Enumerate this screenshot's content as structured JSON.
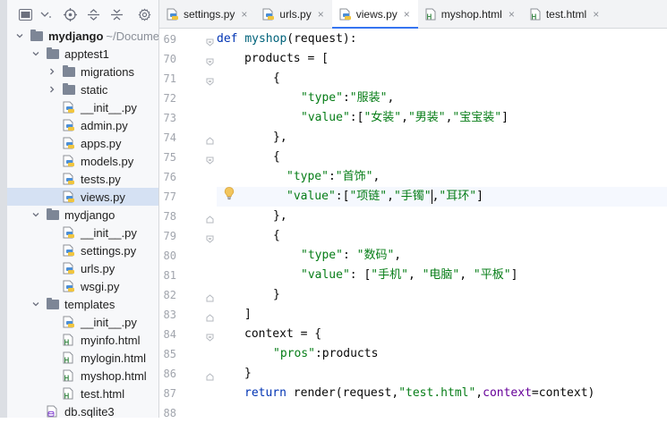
{
  "toolbar": {
    "icons": [
      "project-view-icon",
      "dropdown-icon",
      "locate-icon",
      "expand-all-icon",
      "collapse-all-icon",
      "settings-icon"
    ]
  },
  "tree": [
    {
      "label": "mydjango",
      "sub": "~/Documen",
      "kind": "folder",
      "depth": 0,
      "expanded": true,
      "bold": true
    },
    {
      "label": "apptest1",
      "kind": "folder",
      "depth": 1,
      "expanded": true
    },
    {
      "label": "migrations",
      "kind": "folder",
      "depth": 2,
      "expanded": false
    },
    {
      "label": "static",
      "kind": "folder",
      "depth": 2,
      "expanded": false
    },
    {
      "label": "__init__.py",
      "kind": "py",
      "depth": 2
    },
    {
      "label": "admin.py",
      "kind": "py",
      "depth": 2
    },
    {
      "label": "apps.py",
      "kind": "py",
      "depth": 2
    },
    {
      "label": "models.py",
      "kind": "py",
      "depth": 2
    },
    {
      "label": "tests.py",
      "kind": "py",
      "depth": 2
    },
    {
      "label": "views.py",
      "kind": "py",
      "depth": 2,
      "selected": true
    },
    {
      "label": "mydjango",
      "kind": "folder",
      "depth": 1,
      "expanded": true
    },
    {
      "label": "__init__.py",
      "kind": "py",
      "depth": 2
    },
    {
      "label": "settings.py",
      "kind": "py",
      "depth": 2
    },
    {
      "label": "urls.py",
      "kind": "py",
      "depth": 2
    },
    {
      "label": "wsgi.py",
      "kind": "py",
      "depth": 2
    },
    {
      "label": "templates",
      "kind": "folder",
      "depth": 1,
      "expanded": true
    },
    {
      "label": "__init__.py",
      "kind": "py",
      "depth": 2
    },
    {
      "label": "myinfo.html",
      "kind": "html",
      "depth": 2
    },
    {
      "label": "mylogin.html",
      "kind": "html",
      "depth": 2
    },
    {
      "label": "myshop.html",
      "kind": "html",
      "depth": 2
    },
    {
      "label": "test.html",
      "kind": "html",
      "depth": 2
    },
    {
      "label": "db.sqlite3",
      "kind": "db",
      "depth": 1
    }
  ],
  "tabs": [
    {
      "label": "settings.py",
      "kind": "py",
      "active": false
    },
    {
      "label": "urls.py",
      "kind": "py",
      "active": false
    },
    {
      "label": "views.py",
      "kind": "py",
      "active": true
    },
    {
      "label": "myshop.html",
      "kind": "html",
      "active": false
    },
    {
      "label": "test.html",
      "kind": "html",
      "active": false
    }
  ],
  "tab_close_glyph": "×",
  "editor": {
    "current_line": 77,
    "lines": [
      {
        "n": 69,
        "indent": 0,
        "tokens": [
          [
            "kw",
            "def "
          ],
          [
            "fn",
            "myshop"
          ],
          [
            "",
            "(request):"
          ]
        ],
        "fold": "open"
      },
      {
        "n": 70,
        "indent": 1,
        "tokens": [
          [
            "",
            "products = ["
          ]
        ],
        "fold": "open"
      },
      {
        "n": 71,
        "indent": 2,
        "tokens": [
          [
            "",
            "{"
          ]
        ],
        "fold": "open"
      },
      {
        "n": 72,
        "indent": 3,
        "tokens": [
          [
            "str",
            "\"type\""
          ],
          [
            "",
            ":"
          ],
          [
            "str",
            "\"服装\""
          ],
          [
            "",
            ","
          ]
        ]
      },
      {
        "n": 73,
        "indent": 3,
        "tokens": [
          [
            "str",
            "\"value\""
          ],
          [
            "",
            ":["
          ],
          [
            "str",
            "\"女装\""
          ],
          [
            "",
            ","
          ],
          [
            "str",
            "\"男装\""
          ],
          [
            "",
            ","
          ],
          [
            "str",
            "\"宝宝装\""
          ],
          [
            "",
            "]"
          ]
        ]
      },
      {
        "n": 74,
        "indent": 2,
        "tokens": [
          [
            "",
            "},"
          ]
        ],
        "fold": "close"
      },
      {
        "n": 75,
        "indent": 2,
        "tokens": [
          [
            "",
            "{"
          ]
        ],
        "fold": "open"
      },
      {
        "n": 76,
        "indent": 2.5,
        "tokens": [
          [
            "str",
            "\"type\""
          ],
          [
            "",
            ":"
          ],
          [
            "str",
            "\"首饰\""
          ],
          [
            "",
            ","
          ]
        ]
      },
      {
        "n": 77,
        "indent": 2.5,
        "tokens": [
          [
            "str",
            "\"value\""
          ],
          [
            "",
            ":["
          ],
          [
            "str",
            "\"项链\""
          ],
          [
            "",
            ","
          ],
          [
            "str",
            "\"手镯\""
          ],
          [
            "caret",
            ""
          ],
          [
            "",
            ","
          ],
          [
            "str",
            "\"耳环\""
          ],
          [
            "",
            "]"
          ]
        ]
      },
      {
        "n": 78,
        "indent": 2,
        "tokens": [
          [
            "",
            "},"
          ]
        ],
        "fold": "close"
      },
      {
        "n": 79,
        "indent": 2,
        "tokens": [
          [
            "",
            "{"
          ]
        ],
        "fold": "open"
      },
      {
        "n": 80,
        "indent": 3,
        "tokens": [
          [
            "str",
            "\"type\""
          ],
          [
            "",
            ": "
          ],
          [
            "str",
            "\"数码\""
          ],
          [
            "",
            ","
          ]
        ]
      },
      {
        "n": 81,
        "indent": 3,
        "tokens": [
          [
            "str",
            "\"value\""
          ],
          [
            "",
            ": ["
          ],
          [
            "str",
            "\"手机\""
          ],
          [
            "",
            ", "
          ],
          [
            "str",
            "\"电脑\""
          ],
          [
            "",
            ", "
          ],
          [
            "str",
            "\"平板\""
          ],
          [
            "",
            "]"
          ]
        ]
      },
      {
        "n": 82,
        "indent": 2,
        "tokens": [
          [
            "",
            "}"
          ]
        ],
        "fold": "close"
      },
      {
        "n": 83,
        "indent": 1,
        "tokens": [
          [
            "",
            "]"
          ]
        ],
        "fold": "close"
      },
      {
        "n": 84,
        "indent": 1,
        "tokens": [
          [
            "",
            "context = {"
          ]
        ],
        "fold": "open"
      },
      {
        "n": 85,
        "indent": 2,
        "tokens": [
          [
            "str",
            "\"pros\""
          ],
          [
            "",
            ":products"
          ]
        ]
      },
      {
        "n": 86,
        "indent": 1,
        "tokens": [
          [
            "",
            "}"
          ]
        ],
        "fold": "close"
      },
      {
        "n": 87,
        "indent": 1,
        "tokens": [
          [
            "kw",
            "return "
          ],
          [
            "",
            "render(request,"
          ],
          [
            "str",
            "\"test.html\""
          ],
          [
            "",
            ","
          ],
          [
            "param",
            "context"
          ],
          [
            "",
            "=context)"
          ]
        ]
      },
      {
        "n": 88,
        "indent": 0,
        "tokens": []
      }
    ]
  },
  "colors": {
    "accent": "#3574f0",
    "selection": "#d5e1f3",
    "keyword": "#0033b3",
    "string": "#067d17",
    "function": "#00627a",
    "named_param": "#660099",
    "line_number": "#a1a5ad"
  }
}
